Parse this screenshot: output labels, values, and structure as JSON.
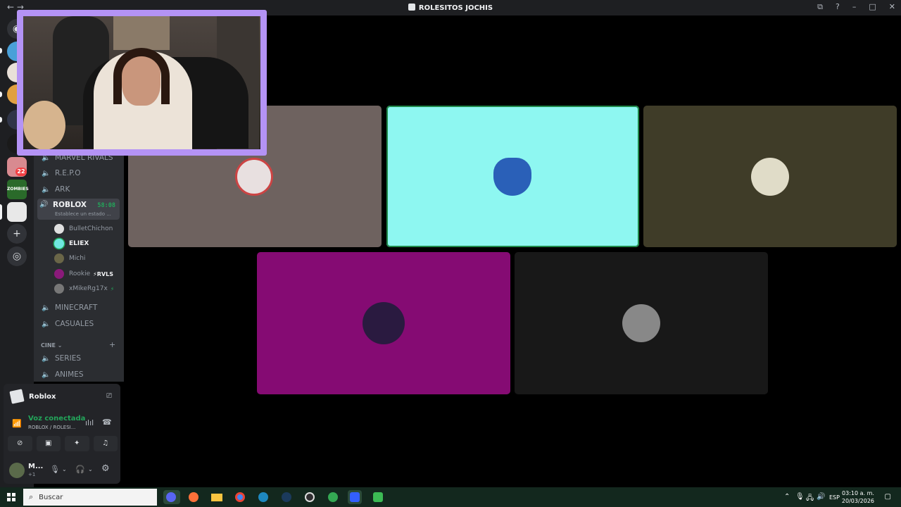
{
  "window": {
    "title": "ROLESITOS JOCHIS",
    "nav": "← →"
  },
  "guilds": {
    "badge_count": "22",
    "zombie_label": "ZOMBIES",
    "add_icon": "+",
    "explore_icon": "◎"
  },
  "channels": [
    {
      "name": "MARVEL RIVALS"
    },
    {
      "name": "R.E.P.O"
    },
    {
      "name": "ARK"
    },
    {
      "name": "ROBLOX",
      "timer": "58:08",
      "status": "Establece un estado ..."
    },
    {
      "name": "MINECRAFT"
    },
    {
      "name": "CASUALES"
    }
  ],
  "voice_users": [
    {
      "name": "BulletChichon"
    },
    {
      "name": "ELIEX"
    },
    {
      "name": "Michi"
    },
    {
      "name": "Rookie",
      "tag": "⚡RVLS"
    },
    {
      "name": "xMikeRg17x",
      "tag": "⚡"
    }
  ],
  "category": {
    "name": "CINE ⌄",
    "add": "+"
  },
  "cine_channels": [
    {
      "name": "SERIES"
    },
    {
      "name": "ANIMES"
    }
  ],
  "activity": {
    "name": "Roblox"
  },
  "voice": {
    "status": "Voz conectada",
    "location": "ROBLOX / ROLESI..."
  },
  "user": {
    "name": "M...",
    "sub": "+1"
  },
  "tiles": [
    {
      "color": "#6e625f"
    },
    {
      "color": "#8ef7f1"
    },
    {
      "color": "#3f3c28"
    },
    {
      "color": "#850b73"
    },
    {
      "color": "#181818"
    }
  ],
  "taskbar": {
    "search": "Buscar",
    "lang": "ESP",
    "time": "03:10 a. m.",
    "date": "20/03/2026"
  }
}
